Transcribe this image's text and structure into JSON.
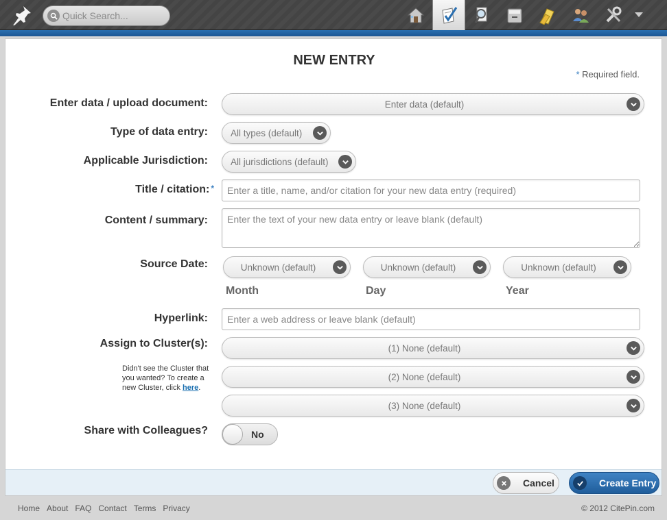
{
  "search": {
    "placeholder": "Quick Search..."
  },
  "nav": {
    "icons": [
      "home-icon",
      "entry-icon",
      "research-icon",
      "storage-icon",
      "documents-icon",
      "colleagues-icon",
      "settings-icon",
      "dropdown-icon"
    ],
    "active": "entry-icon"
  },
  "form": {
    "title": "NEW ENTRY",
    "required_star": "*",
    "required_note": " Required field.",
    "enter_data": {
      "label": "Enter data / upload document:",
      "value": "Enter data (default)"
    },
    "type": {
      "label": "Type of data entry:",
      "value": "All types (default)"
    },
    "jurisdiction": {
      "label": "Applicable Jurisdiction:",
      "value": "All jurisdictions (default)"
    },
    "title_field": {
      "label": "Title / citation:",
      "star": "*",
      "placeholder": "Enter a title, name, and/or citation for your new data entry (required)"
    },
    "content": {
      "label": "Content / summary:",
      "placeholder": "Enter the text of your new data entry or leave blank (default)"
    },
    "source_date": {
      "label": "Source Date:",
      "month": {
        "value": "Unknown (default)",
        "caption": "Month"
      },
      "day": {
        "value": "Unknown (default)",
        "caption": "Day"
      },
      "year": {
        "value": "Unknown (default)",
        "caption": "Year"
      }
    },
    "hyperlink": {
      "label": "Hyperlink:",
      "placeholder": "Enter a web address or leave blank (default)"
    },
    "clusters": {
      "label": "Assign to Cluster(s):",
      "items": [
        "(1)   None (default)",
        "(2)   None (default)",
        "(3)   None (default)"
      ],
      "help_text": "Didn't see the Cluster that you wanted? To create a new Cluster, click ",
      "help_link": "here",
      "help_end": "."
    },
    "share": {
      "label": "Share with Colleagues?",
      "value": "No"
    },
    "buttons": {
      "cancel": "Cancel",
      "create": "Create Entry"
    }
  },
  "footer": {
    "links": [
      "Home",
      "About",
      "FAQ",
      "Contact",
      "Terms",
      "Privacy"
    ],
    "copyright": "© 2012 CitePin.com"
  },
  "colors": {
    "accent": "#1d5794",
    "topbar": "#464646",
    "footer_bar": "#e6f0f7"
  }
}
